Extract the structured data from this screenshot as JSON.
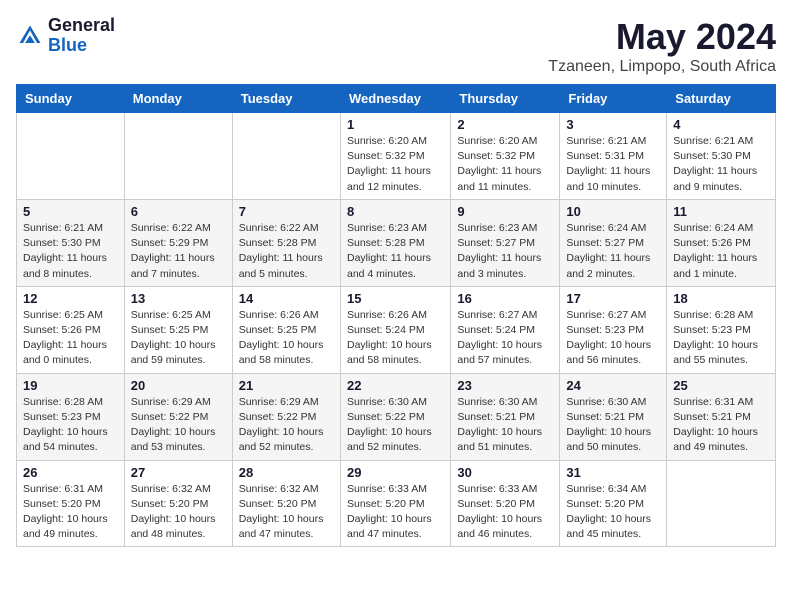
{
  "header": {
    "logo_general": "General",
    "logo_blue": "Blue",
    "title": "May 2024",
    "subtitle": "Tzaneen, Limpopo, South Africa"
  },
  "weekdays": [
    "Sunday",
    "Monday",
    "Tuesday",
    "Wednesday",
    "Thursday",
    "Friday",
    "Saturday"
  ],
  "weeks": [
    [
      {
        "day": "",
        "info": ""
      },
      {
        "day": "",
        "info": ""
      },
      {
        "day": "",
        "info": ""
      },
      {
        "day": "1",
        "info": "Sunrise: 6:20 AM\nSunset: 5:32 PM\nDaylight: 11 hours and 12 minutes."
      },
      {
        "day": "2",
        "info": "Sunrise: 6:20 AM\nSunset: 5:32 PM\nDaylight: 11 hours and 11 minutes."
      },
      {
        "day": "3",
        "info": "Sunrise: 6:21 AM\nSunset: 5:31 PM\nDaylight: 11 hours and 10 minutes."
      },
      {
        "day": "4",
        "info": "Sunrise: 6:21 AM\nSunset: 5:30 PM\nDaylight: 11 hours and 9 minutes."
      }
    ],
    [
      {
        "day": "5",
        "info": "Sunrise: 6:21 AM\nSunset: 5:30 PM\nDaylight: 11 hours and 8 minutes."
      },
      {
        "day": "6",
        "info": "Sunrise: 6:22 AM\nSunset: 5:29 PM\nDaylight: 11 hours and 7 minutes."
      },
      {
        "day": "7",
        "info": "Sunrise: 6:22 AM\nSunset: 5:28 PM\nDaylight: 11 hours and 5 minutes."
      },
      {
        "day": "8",
        "info": "Sunrise: 6:23 AM\nSunset: 5:28 PM\nDaylight: 11 hours and 4 minutes."
      },
      {
        "day": "9",
        "info": "Sunrise: 6:23 AM\nSunset: 5:27 PM\nDaylight: 11 hours and 3 minutes."
      },
      {
        "day": "10",
        "info": "Sunrise: 6:24 AM\nSunset: 5:27 PM\nDaylight: 11 hours and 2 minutes."
      },
      {
        "day": "11",
        "info": "Sunrise: 6:24 AM\nSunset: 5:26 PM\nDaylight: 11 hours and 1 minute."
      }
    ],
    [
      {
        "day": "12",
        "info": "Sunrise: 6:25 AM\nSunset: 5:26 PM\nDaylight: 11 hours and 0 minutes."
      },
      {
        "day": "13",
        "info": "Sunrise: 6:25 AM\nSunset: 5:25 PM\nDaylight: 10 hours and 59 minutes."
      },
      {
        "day": "14",
        "info": "Sunrise: 6:26 AM\nSunset: 5:25 PM\nDaylight: 10 hours and 58 minutes."
      },
      {
        "day": "15",
        "info": "Sunrise: 6:26 AM\nSunset: 5:24 PM\nDaylight: 10 hours and 58 minutes."
      },
      {
        "day": "16",
        "info": "Sunrise: 6:27 AM\nSunset: 5:24 PM\nDaylight: 10 hours and 57 minutes."
      },
      {
        "day": "17",
        "info": "Sunrise: 6:27 AM\nSunset: 5:23 PM\nDaylight: 10 hours and 56 minutes."
      },
      {
        "day": "18",
        "info": "Sunrise: 6:28 AM\nSunset: 5:23 PM\nDaylight: 10 hours and 55 minutes."
      }
    ],
    [
      {
        "day": "19",
        "info": "Sunrise: 6:28 AM\nSunset: 5:23 PM\nDaylight: 10 hours and 54 minutes."
      },
      {
        "day": "20",
        "info": "Sunrise: 6:29 AM\nSunset: 5:22 PM\nDaylight: 10 hours and 53 minutes."
      },
      {
        "day": "21",
        "info": "Sunrise: 6:29 AM\nSunset: 5:22 PM\nDaylight: 10 hours and 52 minutes."
      },
      {
        "day": "22",
        "info": "Sunrise: 6:30 AM\nSunset: 5:22 PM\nDaylight: 10 hours and 52 minutes."
      },
      {
        "day": "23",
        "info": "Sunrise: 6:30 AM\nSunset: 5:21 PM\nDaylight: 10 hours and 51 minutes."
      },
      {
        "day": "24",
        "info": "Sunrise: 6:30 AM\nSunset: 5:21 PM\nDaylight: 10 hours and 50 minutes."
      },
      {
        "day": "25",
        "info": "Sunrise: 6:31 AM\nSunset: 5:21 PM\nDaylight: 10 hours and 49 minutes."
      }
    ],
    [
      {
        "day": "26",
        "info": "Sunrise: 6:31 AM\nSunset: 5:20 PM\nDaylight: 10 hours and 49 minutes."
      },
      {
        "day": "27",
        "info": "Sunrise: 6:32 AM\nSunset: 5:20 PM\nDaylight: 10 hours and 48 minutes."
      },
      {
        "day": "28",
        "info": "Sunrise: 6:32 AM\nSunset: 5:20 PM\nDaylight: 10 hours and 47 minutes."
      },
      {
        "day": "29",
        "info": "Sunrise: 6:33 AM\nSunset: 5:20 PM\nDaylight: 10 hours and 47 minutes."
      },
      {
        "day": "30",
        "info": "Sunrise: 6:33 AM\nSunset: 5:20 PM\nDaylight: 10 hours and 46 minutes."
      },
      {
        "day": "31",
        "info": "Sunrise: 6:34 AM\nSunset: 5:20 PM\nDaylight: 10 hours and 45 minutes."
      },
      {
        "day": "",
        "info": ""
      }
    ]
  ]
}
